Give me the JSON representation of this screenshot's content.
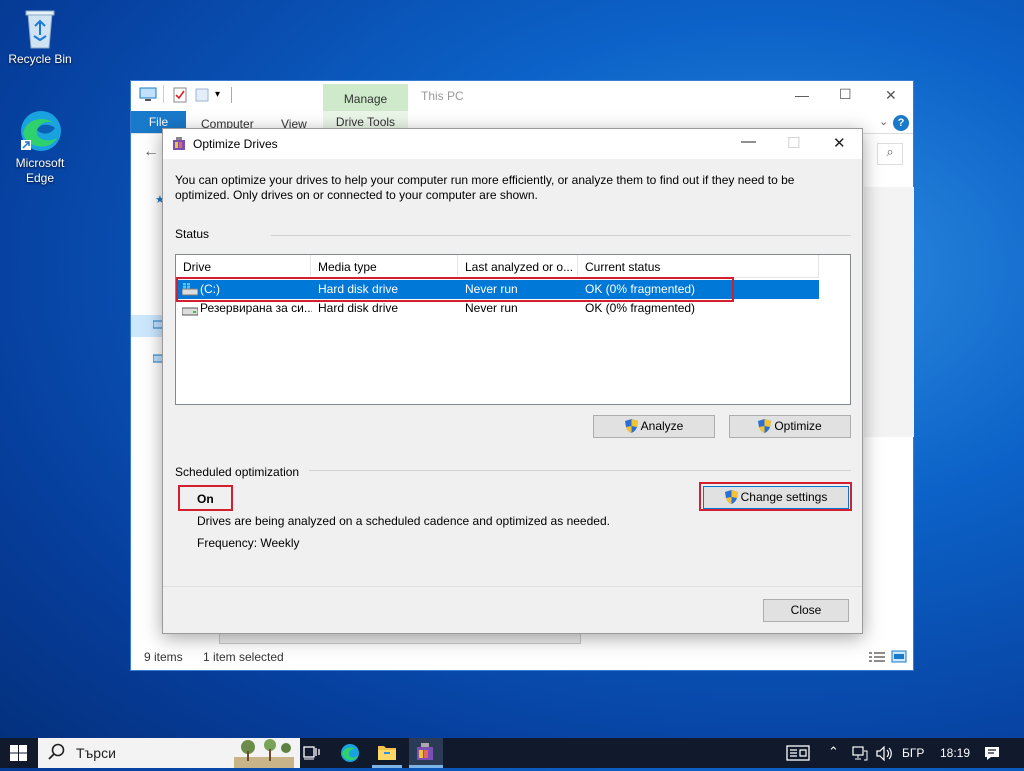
{
  "desktop": {
    "icons": [
      {
        "label": "Recycle Bin",
        "icon": "recycle-bin-icon"
      },
      {
        "label": "Microsoft Edge",
        "icon": "edge-icon"
      }
    ]
  },
  "explorer": {
    "title": "This PC",
    "manage_tab": "Manage",
    "ribbon_tabs": [
      "File",
      "Computer",
      "View"
    ],
    "drive_tools_tab": "Drive Tools",
    "status_items": "9 items",
    "status_selected": "1 item selected"
  },
  "dialog": {
    "title": "Optimize Drives",
    "description": "You can optimize your drives to help your computer run more efficiently, or analyze them to find out if they need to be optimized. Only drives on or connected to your computer are shown.",
    "status_label": "Status",
    "columns": [
      "Drive",
      "Media type",
      "Last analyzed or o...",
      "Current status"
    ],
    "drives": [
      {
        "drive": "(C:)",
        "media": "Hard disk drive",
        "last": "Never run",
        "status": "OK (0% fragmented)",
        "selected": true
      },
      {
        "drive": "Резервирана за си...",
        "media": "Hard disk drive",
        "last": "Never run",
        "status": "OK (0% fragmented)",
        "selected": false
      }
    ],
    "analyze_label": "Analyze",
    "optimize_label": "Optimize",
    "scheduled_label": "Scheduled optimization",
    "scheduled_state": "On",
    "change_settings_label": "Change settings",
    "schedule_desc": "Drives are being analyzed on a scheduled cadence and optimized as needed.",
    "frequency": "Frequency: Weekly",
    "close_label": "Close"
  },
  "taskbar": {
    "search_placeholder": "Търси",
    "language": "БГР",
    "time": "18:19"
  },
  "colors": {
    "accent": "#0078d7",
    "highlight_box": "#d32030",
    "manage_tab": "#cfeacb"
  }
}
